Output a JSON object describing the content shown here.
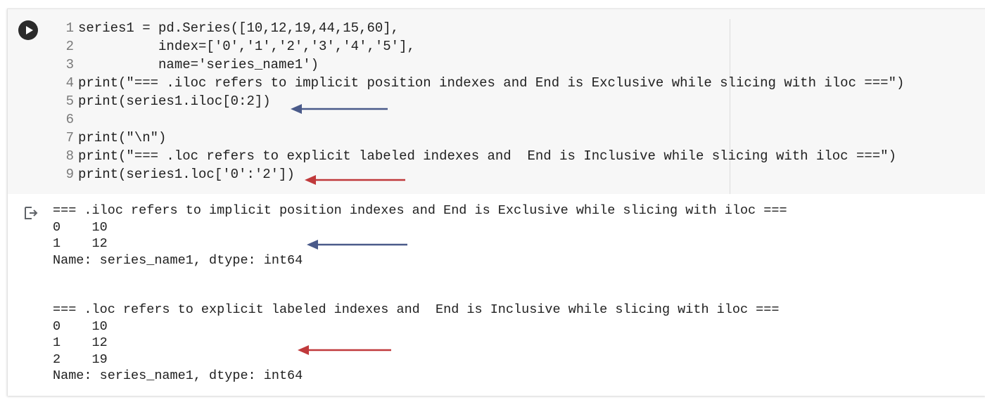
{
  "code_cell": {
    "lines": [
      {
        "num": "1",
        "text": "series1 = pd.Series([10,12,19,44,15,60],"
      },
      {
        "num": "2",
        "text": "          index=['0','1','2','3','4','5'],"
      },
      {
        "num": "3",
        "text": "          name='series_name1')"
      },
      {
        "num": "4",
        "text": "print(\"=== .iloc refers to implicit position indexes and End is Exclusive while slicing with iloc ===\")"
      },
      {
        "num": "5",
        "text": "print(series1.iloc[0:2])"
      },
      {
        "num": "6",
        "text": ""
      },
      {
        "num": "7",
        "text": "print(\"\\n\")"
      },
      {
        "num": "8",
        "text": "print(\"=== .loc refers to explicit labeled indexes and  End is Inclusive while slicing with iloc ===\")"
      },
      {
        "num": "9",
        "text": "print(series1.loc['0':'2'])"
      }
    ]
  },
  "output": {
    "lines": [
      "=== .iloc refers to implicit position indexes and End is Exclusive while slicing with iloc ===",
      "0    10",
      "1    12",
      "Name: series_name1, dtype: int64",
      "",
      "",
      "=== .loc refers to explicit labeled indexes and  End is Inclusive while slicing with iloc ===",
      "0    10",
      "1    12",
      "2    19",
      "Name: series_name1, dtype: int64"
    ]
  },
  "icons": {
    "run": "play-icon",
    "output": "output-redirect-icon"
  },
  "colors": {
    "code_background": "#f7f7f7",
    "string": "#a31515",
    "number": "#098658",
    "arrow_blue": "#4a5a8a",
    "arrow_red": "#c0393b"
  }
}
